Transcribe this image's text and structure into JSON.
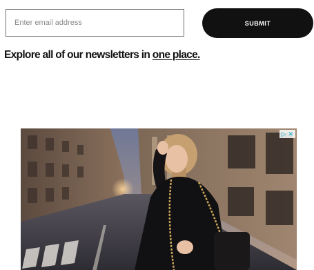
{
  "newsletter": {
    "email_placeholder": "Enter email address",
    "submit_label": "SUBMIT",
    "explore_text": "Explore all of our newsletters in ",
    "explore_link": "one place."
  },
  "ad": {
    "icons": [
      "adchoices-icon",
      "close-icon"
    ],
    "accent_color": "#00aecd"
  }
}
